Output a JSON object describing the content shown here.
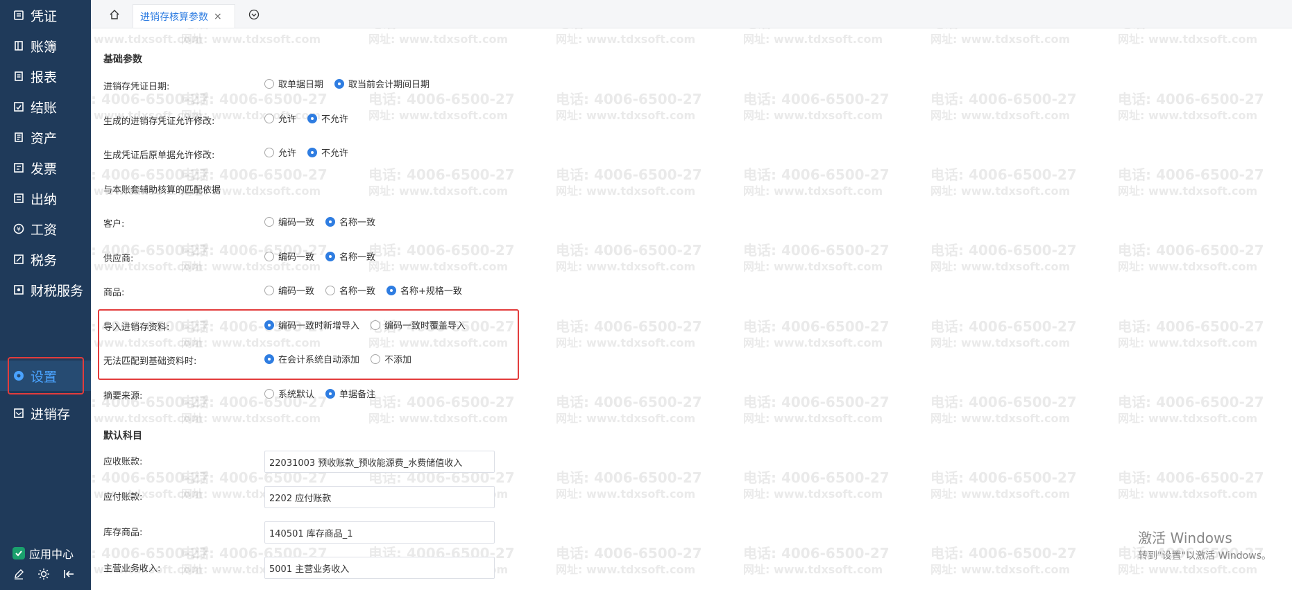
{
  "sidebar": {
    "items": [
      {
        "label": "凭证",
        "icon": "document-icon"
      },
      {
        "label": "账簿",
        "icon": "book-icon"
      },
      {
        "label": "报表",
        "icon": "report-icon"
      },
      {
        "label": "结账",
        "icon": "checkout-icon"
      },
      {
        "label": "资产",
        "icon": "asset-icon"
      },
      {
        "label": "发票",
        "icon": "invoice-icon"
      },
      {
        "label": "出纳",
        "icon": "cash-icon"
      },
      {
        "label": "工资",
        "icon": "salary-icon"
      },
      {
        "label": "税务",
        "icon": "tax-icon"
      },
      {
        "label": "财税服务",
        "icon": "service-icon"
      },
      {
        "label": "设置",
        "icon": "gear-icon",
        "active": true
      },
      {
        "label": "进销存",
        "icon": "inventory-icon"
      }
    ],
    "footer": {
      "app_center": "应用中心",
      "icons": [
        "edit-icon",
        "sun-icon",
        "collapse-icon"
      ]
    }
  },
  "tabs": {
    "home_icon": "home-icon",
    "active_tab": "进销存核算参数",
    "close_icon": "close-icon",
    "menu_icon": "chevron-down-icon"
  },
  "content": {
    "section_basic": "基础参数",
    "rows": {
      "voucher_date": {
        "label": "进销存凭证日期:",
        "options": [
          {
            "label": "取单据日期",
            "checked": false
          },
          {
            "label": "取当前会计期间日期",
            "checked": true
          }
        ]
      },
      "voucher_modify": {
        "label": "生成的进销存凭证允许修改:",
        "options": [
          {
            "label": "允许",
            "checked": false
          },
          {
            "label": "不允许",
            "checked": true
          }
        ]
      },
      "source_modify": {
        "label": "生成凭证后原单据允许修改:",
        "options": [
          {
            "label": "允许",
            "checked": false
          },
          {
            "label": "不允许",
            "checked": true
          }
        ]
      },
      "match_basis_title": "与本账套辅助核算的匹配依据",
      "customer": {
        "label": "客户:",
        "options": [
          {
            "label": "编码一致",
            "checked": false
          },
          {
            "label": "名称一致",
            "checked": true
          }
        ]
      },
      "supplier": {
        "label": "供应商:",
        "options": [
          {
            "label": "编码一致",
            "checked": false
          },
          {
            "label": "名称一致",
            "checked": true
          }
        ]
      },
      "product": {
        "label": "商品:",
        "options": [
          {
            "label": "编码一致",
            "checked": false
          },
          {
            "label": "名称一致",
            "checked": false
          },
          {
            "label": "名称+规格一致",
            "checked": true
          }
        ]
      },
      "import_inventory": {
        "label": "导入进销存资料:",
        "options": [
          {
            "label": "编码一致时新增导入",
            "checked": true
          },
          {
            "label": "编码一致时覆盖导入",
            "checked": false
          }
        ]
      },
      "unmatched_basic": {
        "label": "无法匹配到基础资料时:",
        "options": [
          {
            "label": "在会计系统自动添加",
            "checked": true
          },
          {
            "label": "不添加",
            "checked": false
          }
        ]
      },
      "summary_source": {
        "label": "摘要来源:",
        "options": [
          {
            "label": "系统默认",
            "checked": false
          },
          {
            "label": "单据备注",
            "checked": true
          }
        ]
      }
    },
    "section_default_accounts": "默认科目",
    "accounts": {
      "receivable": {
        "label": "应收账款:",
        "value": "22031003 预收账款_预收能源费_水费储值收入"
      },
      "payable": {
        "label": "应付账款:",
        "value": "2202 应付账款"
      },
      "inventory": {
        "label": "库存商品:",
        "value": "140501 库存商品_1"
      },
      "main_revenue": {
        "label": "主营业务收入:",
        "value": "5001 主营业务收入"
      }
    },
    "watermark": {
      "phone": "电话: 4006-6500-27",
      "site": "网址: www.tdxsoft.com"
    }
  },
  "windows_activation": {
    "line1": "激活 Windows",
    "line2": "转到\"设置\"以激活 Windows。"
  },
  "colors": {
    "sidebar_bg": "#1f3a5a",
    "accent_blue": "#2f7de1",
    "highlight_red": "#e33c3c"
  }
}
